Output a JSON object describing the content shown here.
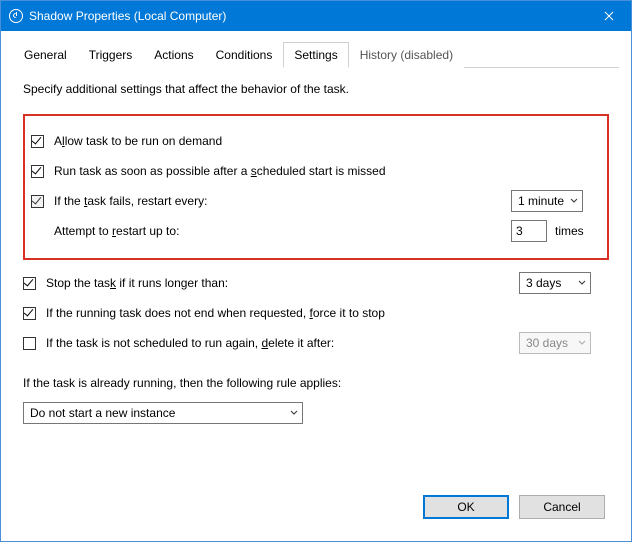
{
  "window": {
    "title": "Shadow Properties (Local Computer)"
  },
  "tabs": {
    "t0": "General",
    "t1": "Triggers",
    "t2": "Actions",
    "t3": "Conditions",
    "t4": "Settings",
    "t5": "History (disabled)"
  },
  "intro": "Specify additional settings that affect the behavior of the task.",
  "options": {
    "allow_demand": {
      "label_pre": "A",
      "label_u": "l",
      "label_post": "low task to be run on demand"
    },
    "run_asap": {
      "label_pre": "Run task as soon as possible after a ",
      "label_u": "s",
      "label_post": "cheduled start is missed"
    },
    "restart_fail": {
      "label_pre": "If the ",
      "label_u": "t",
      "label_post": "ask fails, restart every:"
    },
    "restart_interval": "1 minute",
    "attempt": {
      "label_pre": "Attempt to ",
      "label_u": "r",
      "label_post": "estart up to:"
    },
    "attempt_count": "3",
    "attempt_suffix": "times",
    "stop_longer": {
      "label_pre": "Stop the tas",
      "label_u": "k",
      "label_post": " if it runs longer than:"
    },
    "stop_duration": "3 days",
    "force_stop": {
      "label_pre": "If the running task does not end when requested, ",
      "label_u": "f",
      "label_post": "orce it to stop"
    },
    "delete_after": {
      "label_pre": "If the task is not scheduled to run again, ",
      "label_u": "d",
      "label_post": "elete it after:"
    },
    "delete_duration": "30 days",
    "running_rule_intro": "If the task is already running, then the following rule applies:",
    "running_rule": "Do not start a new instance"
  },
  "buttons": {
    "ok": "OK",
    "cancel": "Cancel"
  }
}
